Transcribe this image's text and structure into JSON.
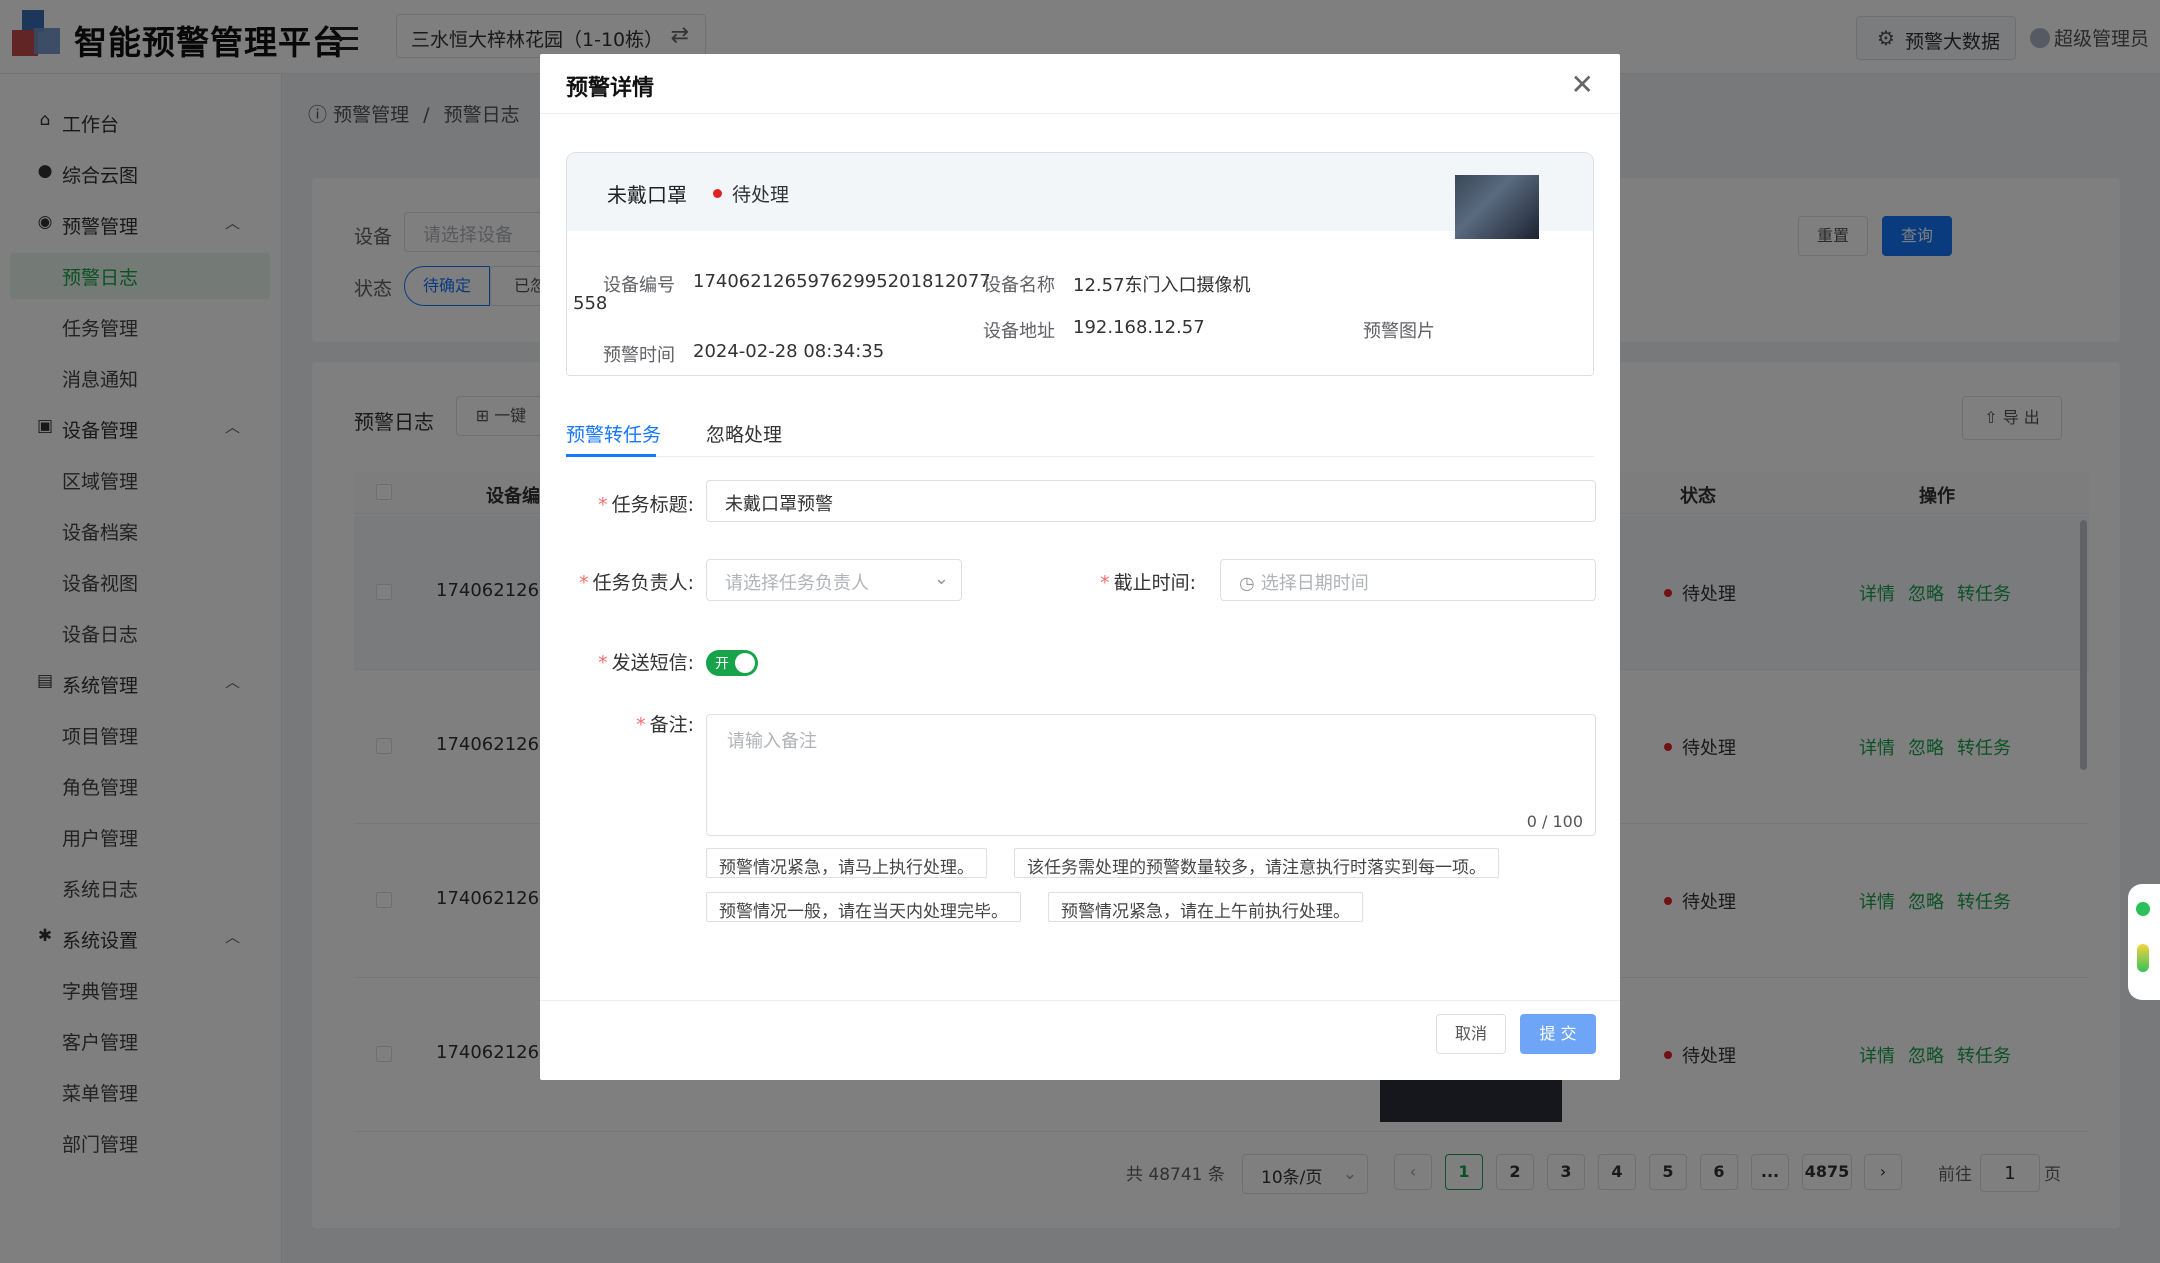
{
  "header": {
    "title": "智能预警管理平台",
    "project": "三水恒大梓林花园（1-10栋）",
    "bigdata_label": "预警大数据",
    "user": "超级管理员"
  },
  "sidebar": {
    "workbench": "工作台",
    "cloud": "综合云图",
    "warning_mgmt": "预警管理",
    "warning_log": "预警日志",
    "task_mgmt": "任务管理",
    "msg_notice": "消息通知",
    "device_mgmt": "设备管理",
    "area_mgmt": "区域管理",
    "device_archive": "设备档案",
    "device_view": "设备视图",
    "device_log": "设备日志",
    "system_mgmt": "系统管理",
    "project_mgmt": "项目管理",
    "role_mgmt": "角色管理",
    "user_mgmt": "用户管理",
    "system_log": "系统日志",
    "system_settings": "系统设置",
    "dict_mgmt": "字典管理",
    "customer_mgmt": "客户管理",
    "menu_mgmt": "菜单管理",
    "dept_mgmt": "部门管理"
  },
  "breadcrumb": {
    "level1": "预警管理",
    "sep": "/",
    "level2": "预警日志"
  },
  "filters": {
    "device_label": "设备",
    "device_placeholder": "请选择设备",
    "status_label": "状态",
    "status_chip1": "待确定",
    "status_chip2": "已忽",
    "reset": "重置",
    "query": "查询"
  },
  "list": {
    "title": "预警日志",
    "batch": "一键",
    "export": "导 出",
    "col_device": "设备编",
    "col_status": "状态",
    "col_ops": "操作",
    "rows": [
      {
        "id": "174062126",
        "status": "待处理",
        "op1": "详情",
        "op2": "忽略",
        "op3": "转任务"
      },
      {
        "id": "174062126",
        "status": "待处理",
        "op1": "详情",
        "op2": "忽略",
        "op3": "转任务"
      },
      {
        "id": "174062126",
        "status": "待处理",
        "op1": "详情",
        "op2": "忽略",
        "op3": "转任务"
      },
      {
        "id": "174062126",
        "status": "待处理",
        "op1": "详情",
        "op2": "忽略",
        "op3": "转任务"
      }
    ]
  },
  "pagination": {
    "total": "共 48741 条",
    "page_size": "10条/页",
    "pages": [
      "1",
      "2",
      "3",
      "4",
      "5",
      "6",
      "...",
      "4875"
    ],
    "goto_prefix": "前往",
    "goto_value": "1",
    "goto_suffix": "页"
  },
  "dialog": {
    "title": "预警详情",
    "alert_type": "未戴口罩",
    "alert_status": "待处理",
    "device_no_label": "设备编号",
    "device_no_line1": "17406212659762995201812077",
    "device_no_line2": "558",
    "device_name_label": "设备名称",
    "device_name": "12.57东门入口摄像机",
    "device_addr_label": "设备地址",
    "device_addr": "192.168.12.57",
    "alert_time_label": "预警时间",
    "alert_time": "2024-02-28 08:34:35",
    "alert_image_label": "预警图片",
    "tab_task": "预警转任务",
    "tab_ignore": "忽略处理",
    "task_title_label": "任务标题:",
    "task_title_value": "未戴口罩预警",
    "assignee_label": "任务负责人:",
    "assignee_placeholder": "请选择任务负责人",
    "deadline_label": "截止时间:",
    "deadline_placeholder": "选择日期时间",
    "sms_label": "发送短信:",
    "sms_on": "开",
    "remark_label": "备注:",
    "remark_placeholder": "请输入备注",
    "remark_count": "0 / 100",
    "quick_remarks": [
      "预警情况紧急，请马上执行处理。",
      "该任务需处理的预警数量较多，请注意执行时落实到每一项。",
      "预警情况一般，请在当天内处理完毕。",
      "预警情况紧急，请在上午前执行处理。"
    ],
    "cancel": "取消",
    "submit": "提 交"
  }
}
